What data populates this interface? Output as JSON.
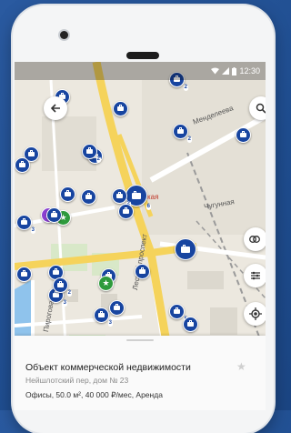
{
  "status_bar": {
    "time": "12:30"
  },
  "map": {
    "labels": {
      "street_1": "Менделеева",
      "street_2": "Чугунная",
      "street_3": "Лесной проспект",
      "street_4": "ская",
      "street_5": "Пирогова",
      "street_6": "ская",
      "street_7": "ская"
    },
    "badges": [
      "2",
      "2",
      "2",
      "3",
      "6",
      "2",
      "3",
      "2",
      "3",
      "5"
    ]
  },
  "controls": {
    "back_icon": "arrow-back-icon",
    "search_icon": "search-icon",
    "transport_icon": "metro-icon",
    "filter_icon": "filter-icon",
    "location_icon": "locate-icon"
  },
  "sheet": {
    "title": "Объект коммерческой недвижимости",
    "address": "Нейшлотский пер, дом № 23",
    "details": "Офисы, 50.0 м², 40 000 ₽/мес, Аренда"
  },
  "colors": {
    "pin_blue": "#1845a0",
    "pin_green": "#2e9a3c",
    "pin_purple": "#8a3fd1",
    "road_yellow": "#f5d35b"
  }
}
